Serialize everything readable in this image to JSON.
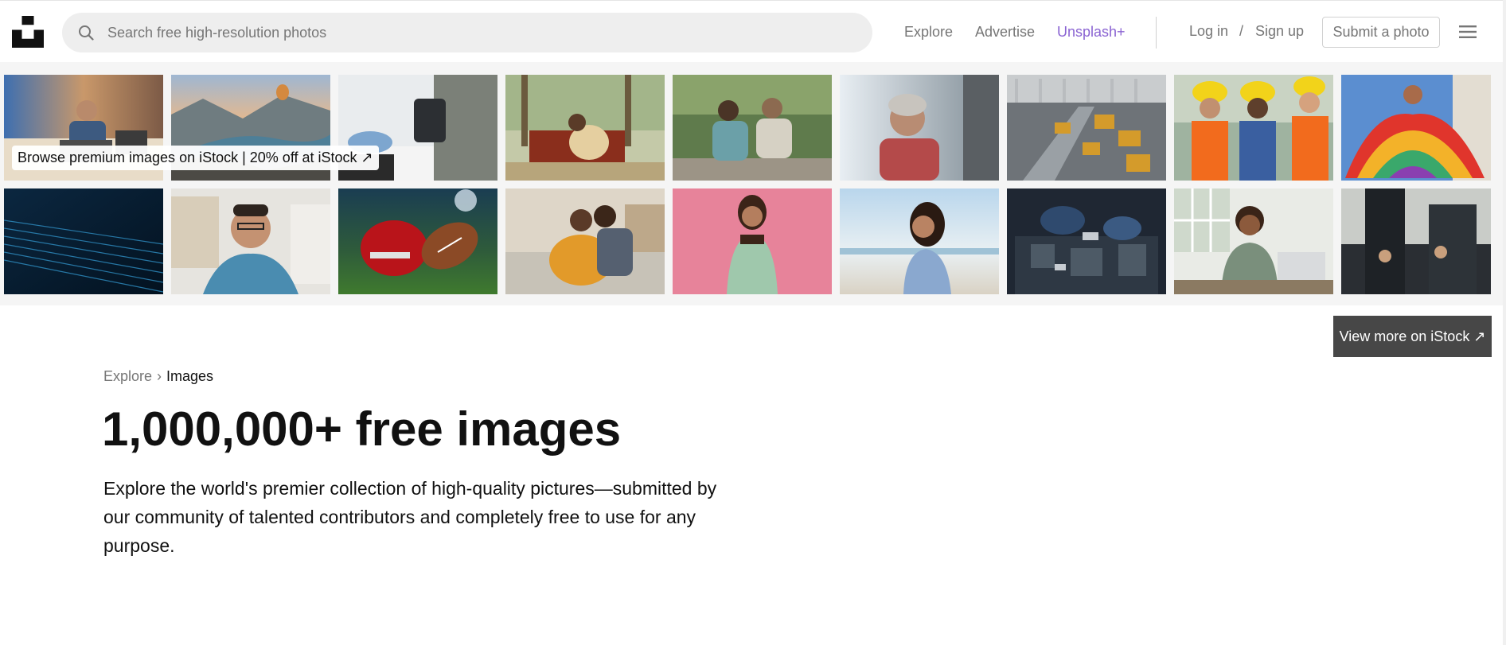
{
  "header": {
    "logo_icon": "unsplash-logo-icon",
    "search": {
      "placeholder": "Search free high-resolution photos",
      "value": "",
      "icon": "search-icon"
    },
    "nav": {
      "explore": "Explore",
      "advertise": "Advertise",
      "unsplash_plus": "Unsplash+",
      "login": "Log in",
      "slash": "/",
      "signup": "Sign up",
      "submit": "Submit a photo",
      "menu_icon": "hamburger-menu-icon"
    },
    "colors": {
      "plus_accent": "#8a63d2",
      "nav_text": "#767676"
    }
  },
  "istock": {
    "promo_label": "Browse premium images on iStock | 20% off at iStock ↗",
    "view_more": "View more on iStock ↗",
    "tiles_row1": [
      {
        "subject": "man working on laptop at desk"
      },
      {
        "subject": "mountain lake valley with hot air balloons"
      },
      {
        "subject": "blood pressure measurement"
      },
      {
        "subject": "girl with dog in pickup truck"
      },
      {
        "subject": "couple looking at phone in park"
      },
      {
        "subject": "smiling older woman"
      },
      {
        "subject": "robotic factory assembly line"
      },
      {
        "subject": "construction workers in hard hats"
      },
      {
        "subject": "dancer in colorful dress"
      }
    ],
    "tiles_row2": [
      {
        "subject": "abstract blue digital lines"
      },
      {
        "subject": "smiling man with glasses"
      },
      {
        "subject": "american football helmet and ball"
      },
      {
        "subject": "pregnant couple on couch"
      },
      {
        "subject": "woman on pink background"
      },
      {
        "subject": "woman smiling at beach"
      },
      {
        "subject": "mechanic working on engine"
      },
      {
        "subject": "woman working at laptop"
      },
      {
        "subject": "business meeting"
      }
    ]
  },
  "main": {
    "breadcrumb": {
      "parent": "Explore",
      "separator": "›",
      "current": "Images"
    },
    "title": "1,000,000+ free images",
    "description": "Explore the world's premier collection of high-quality pictures—submitted by our community of talented contributors and completely free to use for any purpose."
  }
}
